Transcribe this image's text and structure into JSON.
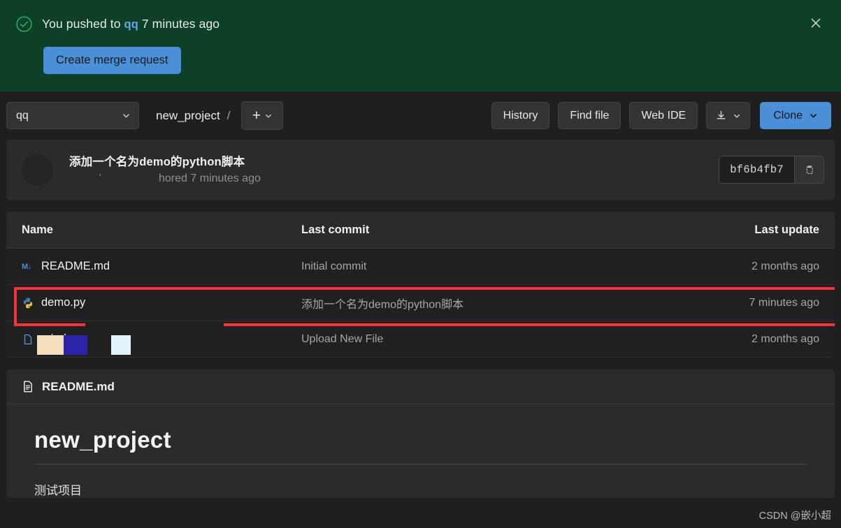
{
  "banner": {
    "status_icon": "check-circle-icon",
    "text_prefix": "You pushed to",
    "branch": "qq",
    "text_suffix": "7 minutes ago",
    "merge_button": "Create merge request",
    "close_icon": "close-icon",
    "bg_color": "#0d4027",
    "accent_color": "#4a90d9"
  },
  "toolbar": {
    "branch_selector": "qq",
    "branch_chevron_icon": "chevron-down-icon",
    "breadcrumb_project": "new_project",
    "breadcrumb_separator": "/",
    "add_icon": "plus-icon",
    "add_chevron_icon": "chevron-down-icon",
    "history_label": "History",
    "find_file_label": "Find file",
    "web_ide_label": "Web IDE",
    "download_icon": "download-icon",
    "download_chevron_icon": "chevron-down-icon",
    "clone_label": "Clone",
    "clone_chevron_icon": "chevron-down-icon"
  },
  "commit": {
    "avatar": "user-avatar",
    "title": "添加一个名为demo的python脚本",
    "meta": "hored 7 minutes ago",
    "sha": "bf6b4fb7",
    "copy_icon": "copy-icon"
  },
  "files": {
    "headers": {
      "name": "Name",
      "last_commit": "Last commit",
      "last_update": "Last update"
    },
    "rows": [
      {
        "icon": "markdown-icon",
        "icon_glyph": "M↓",
        "name": "README.md",
        "last_commit": "Initial commit",
        "last_update": "2 months ago"
      },
      {
        "icon": "python-icon",
        "icon_glyph": "",
        "name": "demo.py",
        "last_commit": "添加一个名为demo的python脚本",
        "last_update": "7 minutes ago"
      },
      {
        "icon": "file-icon",
        "icon_glyph": "",
        "name": "mind",
        "last_commit": "Upload New File",
        "last_update": "2 months ago"
      }
    ],
    "annotation_color": "#f5333f"
  },
  "readme": {
    "file_icon": "document-icon",
    "file_name": "README.md",
    "heading": "new_project",
    "paragraph": "测试项目"
  },
  "watermark": "CSDN @嵌小超"
}
